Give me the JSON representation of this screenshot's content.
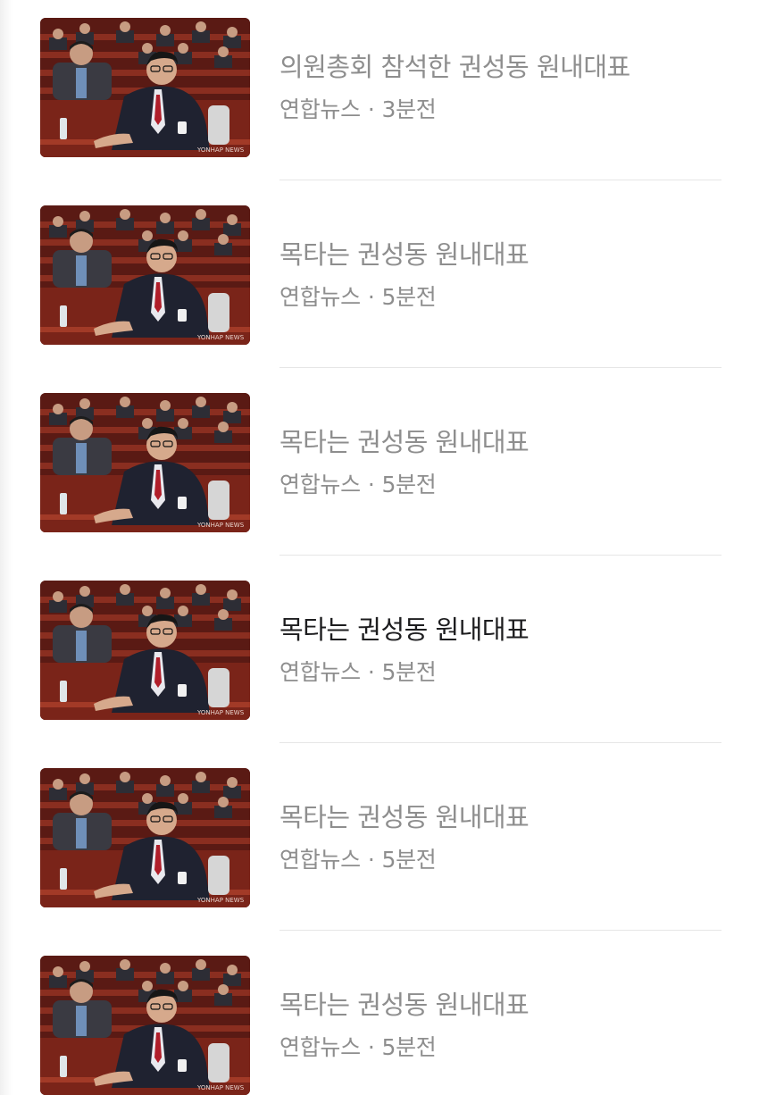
{
  "feed": {
    "items": [
      {
        "title": "의원총회 참석한 권성동 원내대표",
        "source": "연합뉴스",
        "separator": "·",
        "time": "3분전",
        "active": false
      },
      {
        "title": "목타는 권성동 원내대표",
        "source": "연합뉴스",
        "separator": "·",
        "time": "5분전",
        "active": false
      },
      {
        "title": "목타는 권성동 원내대표",
        "source": "연합뉴스",
        "separator": "·",
        "time": "5분전",
        "active": false
      },
      {
        "title": "목타는 권성동 원내대표",
        "source": "연합뉴스",
        "separator": "·",
        "time": "5분전",
        "active": true
      },
      {
        "title": "목타는 권성동 원내대표",
        "source": "연합뉴스",
        "separator": "·",
        "time": "5분전",
        "active": false
      },
      {
        "title": "목타는 권성동 원내대표",
        "source": "연합뉴스",
        "separator": "·",
        "time": "5분전",
        "active": false
      }
    ],
    "thumbnail_watermark": "YONHAP NEWS"
  },
  "colors": {
    "headline_read": "#8e8e8e",
    "headline_active": "#1d1d1f",
    "meta": "#8e8e8e",
    "divider": "#e6e6e6"
  }
}
